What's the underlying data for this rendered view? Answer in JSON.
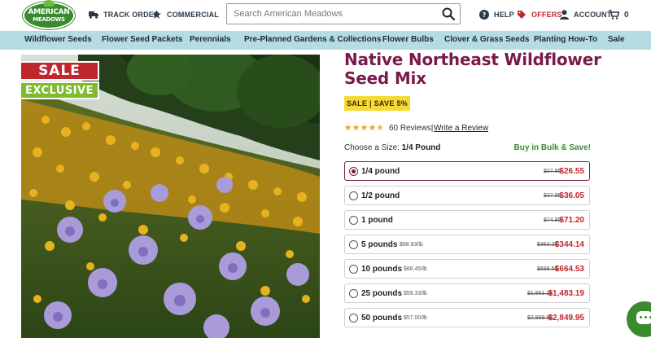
{
  "header": {
    "logo_line1": "AMERICAN",
    "logo_line2": "MEADOWS",
    "track_order": "TRACK ORDER",
    "commercial": "COMMERCIAL",
    "search_placeholder": "Search American Meadows",
    "help": "HELP",
    "offers": "OFFERS",
    "account": "ACCOUNT",
    "cart_count": "0"
  },
  "categories": [
    "Wildflower Seeds",
    "Flower Seed Packets",
    "Perennials",
    "Pre-Planned Gardens & Collections",
    "Flower Bulbs",
    "Clover & Grass Seeds",
    "Planting How-To",
    "Sale"
  ],
  "image": {
    "sale_tag": "SALE",
    "exclusive_tag": "EXCLUSIVE"
  },
  "product": {
    "title": "Native Northeast Wildflower Seed Mix",
    "sale_badge": "SALE | SAVE 5%",
    "rating": 4.5,
    "reviews": "60 Reviews",
    "separator": "|",
    "write_review": "Write a Review",
    "size_label": "Choose a Size:",
    "size_selected": "1/4 Pound",
    "bulk": "Buy in Bulk & Save!",
    "options": [
      {
        "label": "1/4 pound",
        "unit": "",
        "old": "$27.95",
        "price": "$26.55",
        "selected": true
      },
      {
        "label": "1/2 pound",
        "unit": "",
        "old": "$37.95",
        "price": "$36.05",
        "selected": false
      },
      {
        "label": "1 pound",
        "unit": "",
        "old": "$74.95",
        "price": "$71.20",
        "selected": false
      },
      {
        "label": "5 pounds",
        "unit": "$68.83/lb",
        "old": "$362.25",
        "price": "$344.14",
        "selected": false
      },
      {
        "label": "10 pounds",
        "unit": "$66.45/lb",
        "old": "$699.50",
        "price": "$664.53",
        "selected": false
      },
      {
        "label": "25 pounds",
        "unit": "$59.33/lb",
        "old": "$1,561.25",
        "price": "$1,483.19",
        "selected": false
      },
      {
        "label": "50 pounds",
        "unit": "$57.00/lb",
        "old": "$2,999.95",
        "price": "$2,849.95",
        "selected": false
      }
    ]
  },
  "colors": {
    "brand_green": "#3a8a2e",
    "title_plum": "#7a1a4b",
    "sale_red": "#c0272d",
    "badge_yellow": "#f5d937",
    "nav_blue": "#b5dbe3"
  }
}
